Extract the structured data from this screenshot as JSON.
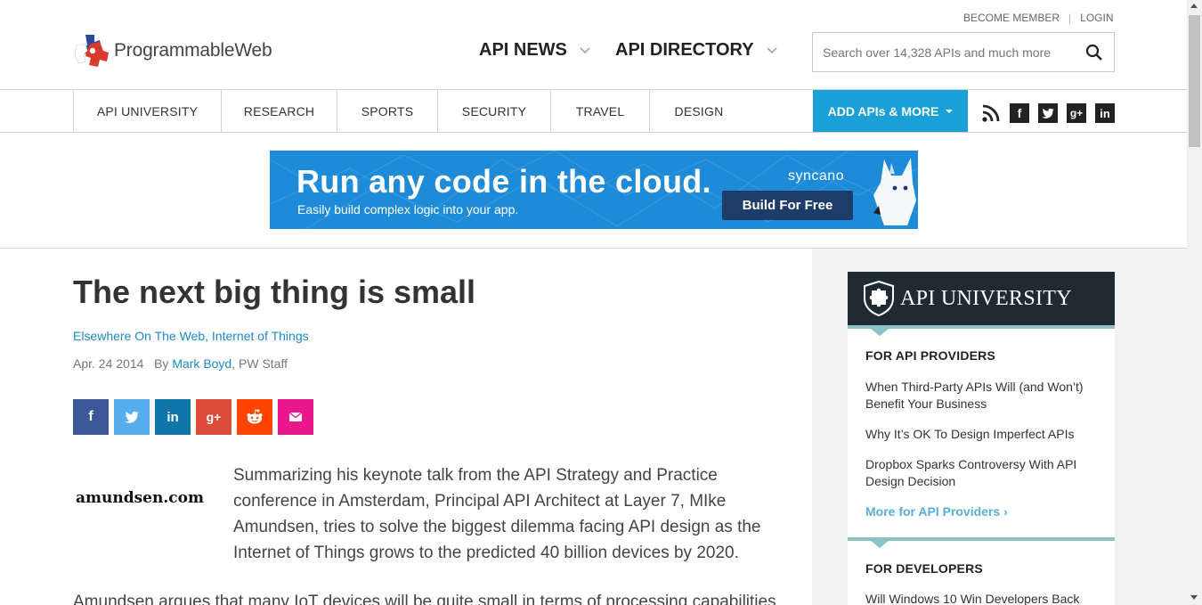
{
  "header": {
    "logo_text": "ProgrammableWeb",
    "become_member": "BECOME MEMBER",
    "separator": "|",
    "login": "LOGIN",
    "nav": [
      {
        "label": "API NEWS",
        "icon": "chevron-down-icon"
      },
      {
        "label": "API DIRECTORY",
        "icon": "chevron-down-icon"
      }
    ],
    "search": {
      "placeholder": "Search over 14,328 APIs and much more",
      "icon": "search-icon"
    }
  },
  "subnav": {
    "items": [
      "API UNIVERSITY",
      "RESEARCH",
      "SPORTS",
      "SECURITY",
      "TRAVEL",
      "DESIGN"
    ],
    "add_button": "ADD APIs & MORE",
    "social": {
      "rss": "rss-icon",
      "facebook": "f",
      "twitter": "twitter-icon",
      "googleplus": "g+",
      "linkedin": "in"
    },
    "accent_color": "#1a9fd6"
  },
  "ad": {
    "headline": "Run any code in the cloud.",
    "subline": "Easily build complex logic into your app.",
    "brand": "syncano",
    "cta": "Build For Free",
    "bg_color": "#1e8bd9"
  },
  "article": {
    "title": "The next big thing is small",
    "categories": [
      "Elsewhere On The Web",
      "Internet of Things"
    ],
    "category_separator": ", ",
    "date": "Apr. 24 2014",
    "by": "By",
    "author": "Mark Boyd",
    "author_suffix": ", PW Staff",
    "share": [
      {
        "name": "facebook",
        "glyph": "f",
        "color": "#3b5998"
      },
      {
        "name": "twitter",
        "glyph": "twitter-icon",
        "color": "#55acee"
      },
      {
        "name": "linkedin",
        "glyph": "in",
        "color": "#0e76a8"
      },
      {
        "name": "googleplus",
        "glyph": "g+",
        "color": "#dd4b39"
      },
      {
        "name": "reddit",
        "glyph": "reddit-icon",
        "color": "#ff4500"
      },
      {
        "name": "email",
        "glyph": "email-icon",
        "color": "#e9168c"
      }
    ],
    "thumb_text": "amundsen.com",
    "para1": "Summarizing his keynote talk from the API Strategy and Practice conference in Amsterdam, Principal API Architect at Layer 7, MIke Amundsen, tries to solve the biggest dilemma facing API design as the Internet of Things grows to the predicted 40 billion devices by 2020.",
    "para2": "Amundsen argues that many IoT devices will be quite small in terms of processing capabilities"
  },
  "sidebar": {
    "api_university": {
      "title": "API UNIVERSITY",
      "providers_head": "FOR API PROVIDERS",
      "providers_links": [
        "When Third-Party APIs Will (and Won’t) Benefit Your Business",
        "Why It’s OK To Design Imperfect APIs",
        "Dropbox Sparks Controversy With API Design Decision"
      ],
      "providers_more": "More for API Providers  ›",
      "developers_head": "FOR DEVELOPERS",
      "developers_links": [
        "Will Windows 10 Win Developers Back"
      ]
    }
  }
}
